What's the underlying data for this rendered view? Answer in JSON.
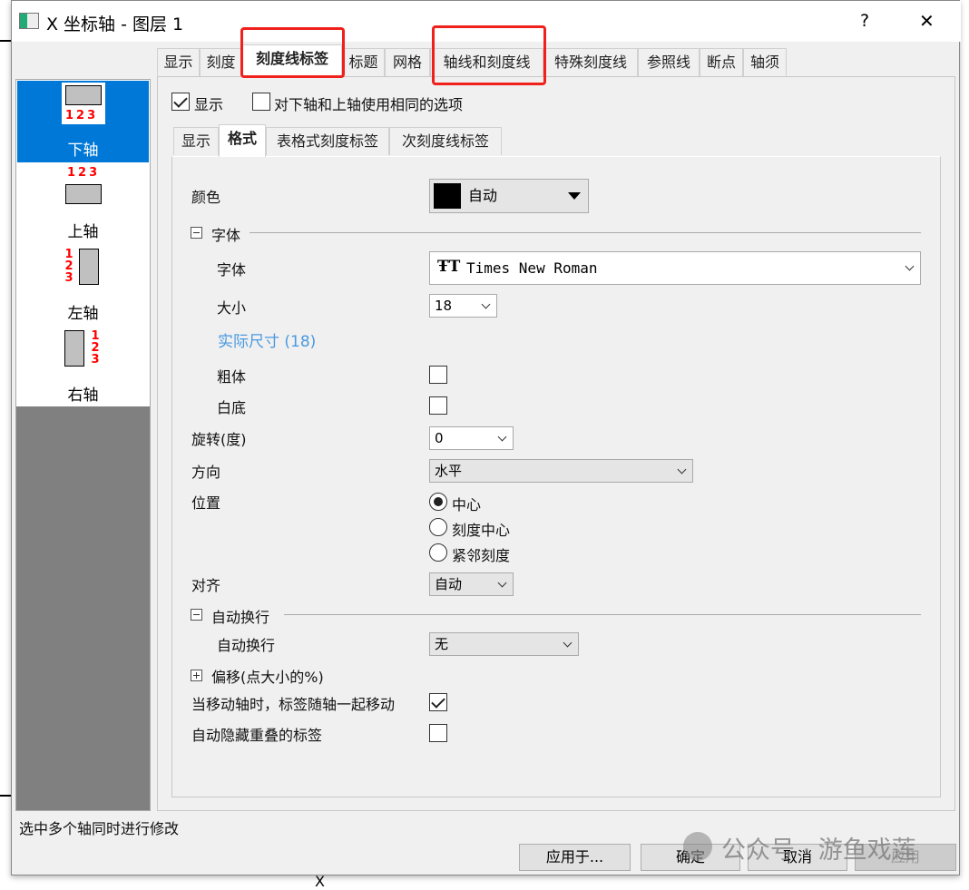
{
  "window": {
    "title": "X 坐标轴 - 图层 1",
    "help": "?",
    "close": "✕"
  },
  "tabs": [
    {
      "label": "显示"
    },
    {
      "label": "刻度"
    },
    {
      "label": "刻度线标签",
      "selected": true
    },
    {
      "label": "标题"
    },
    {
      "label": "网格"
    },
    {
      "label": "轴线和刻度线"
    },
    {
      "label": "特殊刻度线"
    },
    {
      "label": "参照线"
    },
    {
      "label": "断点"
    },
    {
      "label": "轴须"
    }
  ],
  "axes": [
    {
      "label": "下轴",
      "selected": true,
      "icon": "bottom-axis-icon"
    },
    {
      "label": "上轴",
      "icon": "top-axis-icon"
    },
    {
      "label": "左轴",
      "icon": "left-axis-icon"
    },
    {
      "label": "右轴",
      "icon": "right-axis-icon"
    }
  ],
  "axis_icon_digits": [
    "1",
    "2",
    "3"
  ],
  "show": {
    "label": "显示",
    "checked": true
  },
  "same_options": {
    "label": "对下轴和上轴使用相同的选项",
    "checked": false
  },
  "subtabs": [
    {
      "label": "显示"
    },
    {
      "label": "格式",
      "selected": true
    },
    {
      "label": "表格式刻度标签"
    },
    {
      "label": "次刻度线标签"
    }
  ],
  "format": {
    "color": {
      "label": "颜色",
      "value": "自动",
      "swatch": "#000000"
    },
    "font_section": "字体",
    "font": {
      "label": "字体",
      "value": "Times New Roman"
    },
    "size": {
      "label": "大小",
      "value": "18"
    },
    "actual_size": "实际尺寸 (18)",
    "bold": {
      "label": "粗体",
      "checked": false
    },
    "white_bg": {
      "label": "白底",
      "checked": false
    },
    "rotation": {
      "label": "旋转(度)",
      "value": "0"
    },
    "direction": {
      "label": "方向",
      "value": "水平"
    },
    "position": {
      "label": "位置",
      "options": [
        "中心",
        "刻度中心",
        "紧邻刻度"
      ],
      "selected": "中心"
    },
    "align": {
      "label": "对齐",
      "value": "自动"
    },
    "wrap_section": "自动换行",
    "wrap": {
      "label": "自动换行",
      "value": "无"
    },
    "offset_section": "偏移(点大小的%)",
    "move_with_axis": {
      "label": "当移动轴时，标签随轴一起移动",
      "checked": true
    },
    "auto_hide": {
      "label": "自动隐藏重叠的标签",
      "checked": false
    }
  },
  "footer": {
    "hint": "选中多个轴同时进行修改",
    "apply_to": "应用于...",
    "ok": "确定",
    "cancel": "取消",
    "apply": "应用"
  },
  "watermark": "公众号 · 游鱼戏莲",
  "colors": {
    "accent": "#0078d7",
    "highlight": "#f0201c",
    "link": "#4a9ae0"
  }
}
